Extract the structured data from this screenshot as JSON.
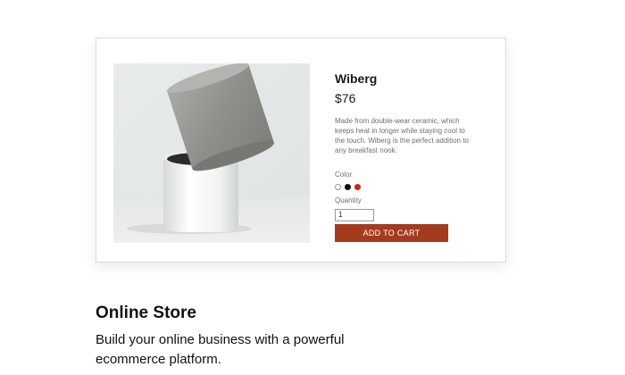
{
  "product": {
    "name": "Wiberg",
    "price": "$76",
    "description": "Made from double-wear ceramic, which keeps heat in longer while staying cool to the touch. Wiberg is the perfect addition to any breakfast nook.",
    "color_label": "Color",
    "colors": [
      {
        "name": "white",
        "hex": "#ffffff"
      },
      {
        "name": "black",
        "hex": "#111111"
      },
      {
        "name": "red",
        "hex": "#d2231e"
      }
    ],
    "quantity_label": "Quantity",
    "quantity_value": "1",
    "add_to_cart_label": "ADD TO CART",
    "button_color": "#a43b1f",
    "image_icon": "concrete-pot-photo"
  },
  "feature": {
    "title": "Online Store",
    "subtitle": "Build your online business with a powerful ecommerce platform."
  }
}
